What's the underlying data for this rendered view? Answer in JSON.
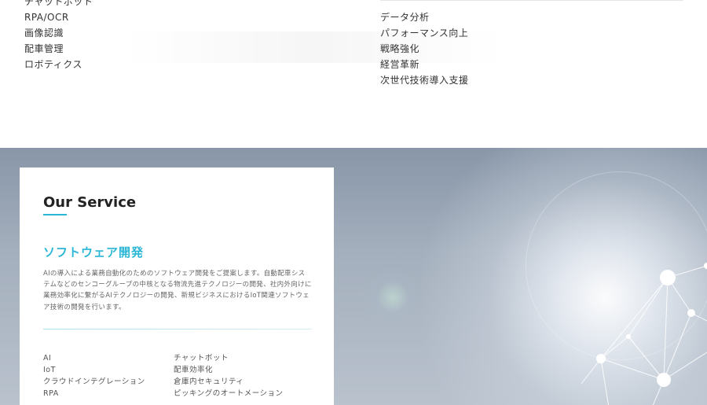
{
  "top_section": {
    "left_list": [
      "チャットボット",
      "RPA/OCR",
      "画像認識",
      "配車管理",
      "ロボティクス"
    ],
    "right_list": [
      "データ分析",
      "パフォーマンス向上",
      "戦略強化",
      "経営革新",
      "次世代技術導入支援"
    ]
  },
  "service_card": {
    "heading": "Our Service",
    "service_title": "ソフトウェア開発",
    "description": "AIの導入による業務自動化のためのソフトウェア開発をご提案します。自動配車システムなどのセンコーグループの中核となる物流先進テクノロジーの開発、社内外向けに業務効率化に繋がるAIテクノロジーの開発、新規ビジネスにおけるIoT関連ソフトウェア技術の開発を行います。",
    "tags_left": [
      "AI",
      "IoT",
      "クラウドインテグレーション",
      "RPA"
    ],
    "tags_right": [
      "チャットボット",
      "配車効率化",
      "倉庫内セキュリティ",
      "ピッキングのオートメーション"
    ]
  },
  "colors": {
    "accent": "#2bb6d6",
    "hero_bg": "#9aa6b5"
  }
}
